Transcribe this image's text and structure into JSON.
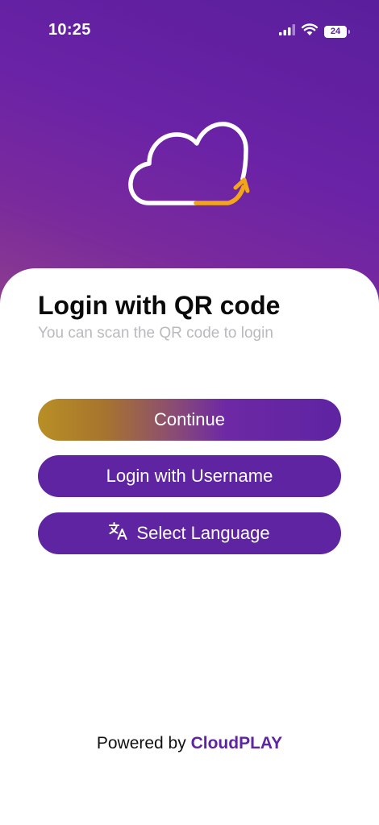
{
  "status_bar": {
    "time": "10:25",
    "battery_level": "24",
    "icons": [
      "signal-icon",
      "wifi-icon",
      "battery-icon"
    ]
  },
  "logo": {
    "icon": "cloud-logo-icon"
  },
  "login": {
    "title": "Login with QR code",
    "subtitle": "You can scan the QR code to login",
    "continue_label": "Continue",
    "username_label": "Login with Username",
    "language_label": "Select Language",
    "language_icon": "translate-icon"
  },
  "footer": {
    "powered_by": "Powered by",
    "brand": "CloudPLAY"
  },
  "colors": {
    "primary": "#5e24a2",
    "accent": "#f2a51a",
    "gold": "#b88f25",
    "subtitle": "#b9b9be"
  }
}
